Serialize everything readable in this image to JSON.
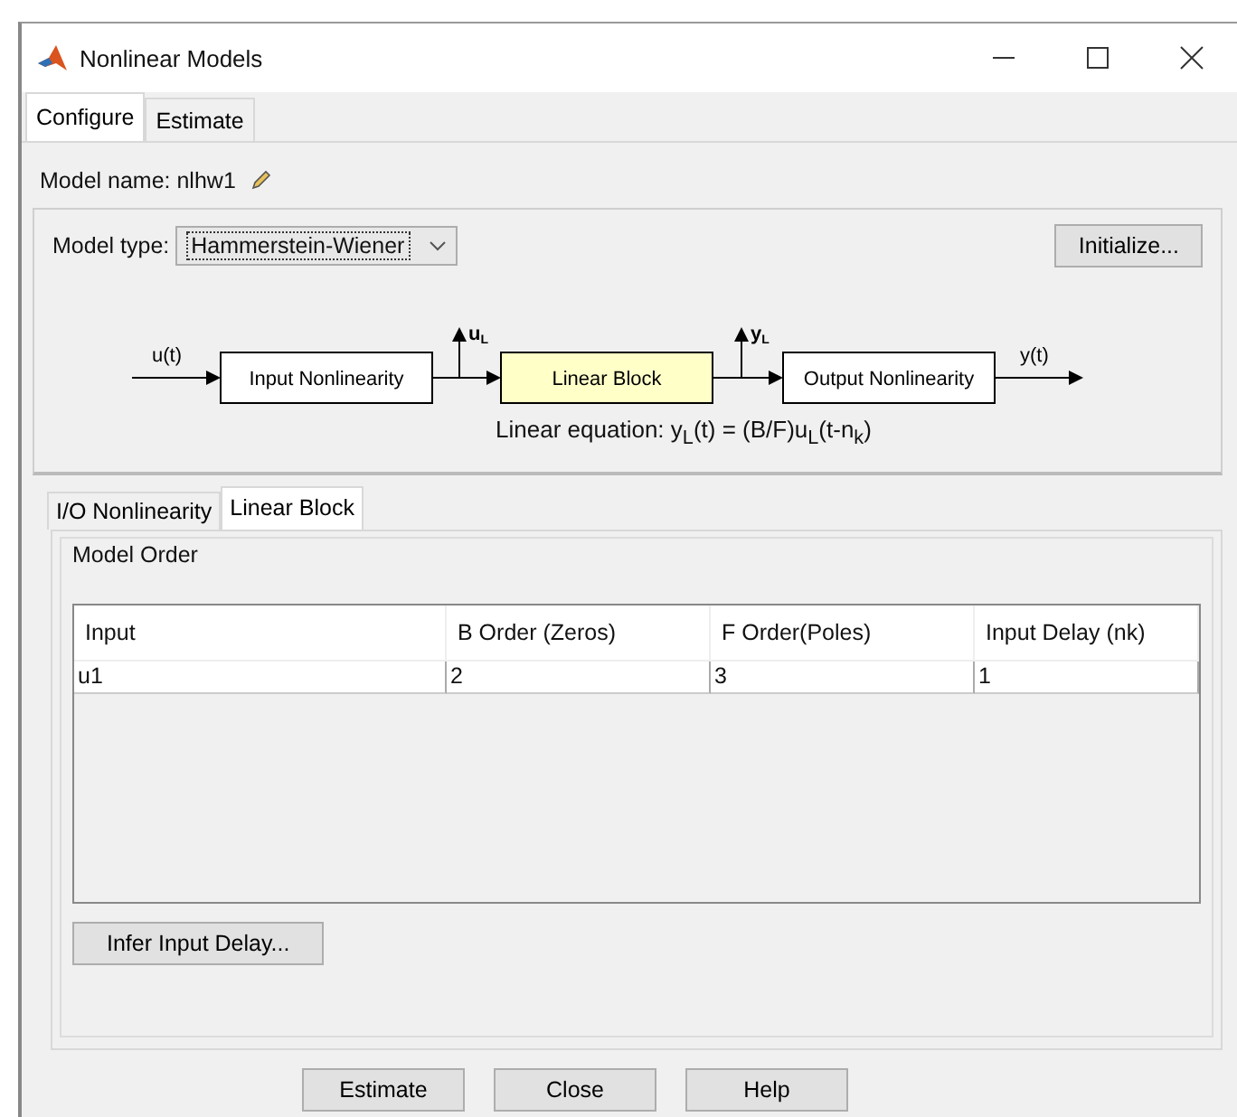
{
  "window": {
    "title": "Nonlinear Models"
  },
  "tabs": [
    {
      "label": "Configure",
      "selected": true
    },
    {
      "label": "Estimate",
      "selected": false
    }
  ],
  "model_name": {
    "label": "Model name:",
    "value": "nlhw1"
  },
  "model_type": {
    "label": "Model type:",
    "value": "Hammerstein-Wiener"
  },
  "initialize_button": "Initialize...",
  "diagram": {
    "input_signal": "u(t)",
    "output_signal": "y(t)",
    "blocks": [
      {
        "label": "Input Nonlinearity",
        "highlighted": false
      },
      {
        "label": "Linear Block",
        "highlighted": true
      },
      {
        "label": "Output Nonlinearity",
        "highlighted": false
      }
    ],
    "taps": [
      {
        "label": "u",
        "subscript": "L"
      },
      {
        "label": "y",
        "subscript": "L"
      }
    ],
    "equation": "Linear equation: y$_{L}$(t) = (B/F)u$_{L}$(t-n$_{k}$)"
  },
  "sub_tabs": [
    {
      "label": "I/O Nonlinearity",
      "selected": false
    },
    {
      "label": "Linear Block",
      "selected": true
    }
  ],
  "model_order": {
    "title": "Model Order",
    "table": {
      "columns": [
        "Input",
        "B Order (Zeros)",
        "F Order(Poles)",
        "Input Delay (nk)"
      ],
      "rows": [
        [
          "u1",
          "2",
          "3",
          "1"
        ]
      ]
    }
  },
  "infer_button": "Infer Input Delay...",
  "buttons": [
    "Estimate",
    "Close",
    "Help"
  ]
}
